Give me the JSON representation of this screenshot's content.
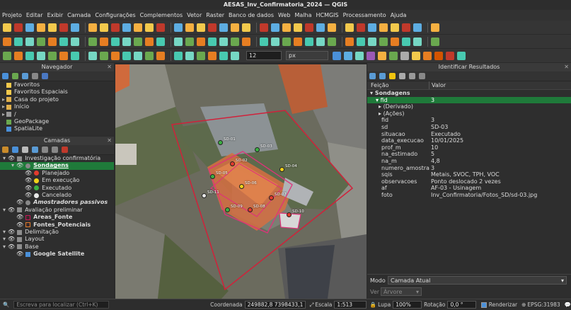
{
  "window": {
    "title": "AESAS_Inv_Confirmatoria_2024 — QGIS"
  },
  "menu": [
    "Projeto",
    "Editar",
    "Exibir",
    "Camada",
    "Configurações",
    "Complementos",
    "Vetor",
    "Raster",
    "Banco de dados",
    "Web",
    "Malha",
    "HCMGIS",
    "Processamento",
    "Ajuda"
  ],
  "digitize": {
    "size_value": "12",
    "unit": "px"
  },
  "navigator": {
    "title": "Navegador",
    "items": [
      "Favoritos",
      "Favoritos Espaciais",
      "Casa do projeto",
      "Início",
      "/",
      "GeoPackage",
      "SpatiaLite"
    ]
  },
  "layers": {
    "title": "Camadas",
    "tree": [
      {
        "label": "Investigação confirmatória",
        "level": 0,
        "kind": "group"
      },
      {
        "label": "Sondagens",
        "level": 1,
        "kind": "layer",
        "selected": true
      },
      {
        "label": "Planejado",
        "level": 2,
        "kind": "class",
        "color": "#e23b2e"
      },
      {
        "label": "Em execução",
        "level": 2,
        "kind": "class",
        "color": "#f2d21a"
      },
      {
        "label": "Executado",
        "level": 2,
        "kind": "class",
        "color": "#3cb043"
      },
      {
        "label": "Cancelado",
        "level": 2,
        "kind": "class",
        "color": "#e8e8e8"
      },
      {
        "label": "Amostradores passivos",
        "level": 1,
        "kind": "layer-italic"
      },
      {
        "label": "Avaliação preliminar",
        "level": 0,
        "kind": "group"
      },
      {
        "label": "Areas_Fonte",
        "level": 1,
        "kind": "poly",
        "color": "#c2185b"
      },
      {
        "label": "Fontes_Potenciais",
        "level": 1,
        "kind": "poly",
        "color": "#e07b2a"
      },
      {
        "label": "Delimitação",
        "level": 0,
        "kind": "group"
      },
      {
        "label": "Layout",
        "level": 0,
        "kind": "group"
      },
      {
        "label": "Base",
        "level": 0,
        "kind": "group"
      },
      {
        "label": "Google Satellite",
        "level": 1,
        "kind": "raster"
      }
    ]
  },
  "identify": {
    "title": "Identificar Resultados",
    "col_feature": "Feição",
    "col_value": "Valor",
    "layer": "Sondagens",
    "fid_label": "fid",
    "fid_value": "3",
    "derived": "(Derivado)",
    "actions": "(Ações)",
    "attributes": [
      {
        "k": "fid",
        "v": "3"
      },
      {
        "k": "sd",
        "v": "SD-03"
      },
      {
        "k": "situacao",
        "v": "Executado"
      },
      {
        "k": "data_execucao",
        "v": "10/01/2025"
      },
      {
        "k": "prof_m",
        "v": "10"
      },
      {
        "k": "na_estimado",
        "v": "5"
      },
      {
        "k": "na_m",
        "v": "4,8"
      },
      {
        "k": "numero_amostras",
        "v": "3"
      },
      {
        "k": "sqis",
        "v": "Metais, SVOC, TPH, VOC"
      },
      {
        "k": "observacoes",
        "v": "Ponto deslocado 2 vezes"
      },
      {
        "k": "af",
        "v": "AF-03 - Usinagem"
      },
      {
        "k": "foto",
        "v": "Inv_Confirmatoria/Fotos_SD/sd-03.jpg"
      }
    ],
    "mode_label": "Modo",
    "mode_value": "Camada Atual",
    "view_label": "Ver",
    "view_value": "Árvore"
  },
  "map_labels": [
    "SD-01",
    "SD-02",
    "SD-03",
    "SD-04",
    "SD-05",
    "SD-06",
    "SD-07",
    "SD-08",
    "SD-09",
    "SD-10",
    "SD-11"
  ],
  "status": {
    "search_placeholder": "Escreva para localizar (Ctrl+K)",
    "coord_label": "Coordenada",
    "coord_value": "249882,8 7398433,1",
    "scale_label": "Escala",
    "scale_value": "1:513",
    "magnifier_label": "Lupa",
    "magnifier_value": "100%",
    "rotation_label": "Rotação",
    "rotation_value": "0,0 °",
    "render_label": "Renderizar",
    "crs": "EPSG:31983"
  }
}
